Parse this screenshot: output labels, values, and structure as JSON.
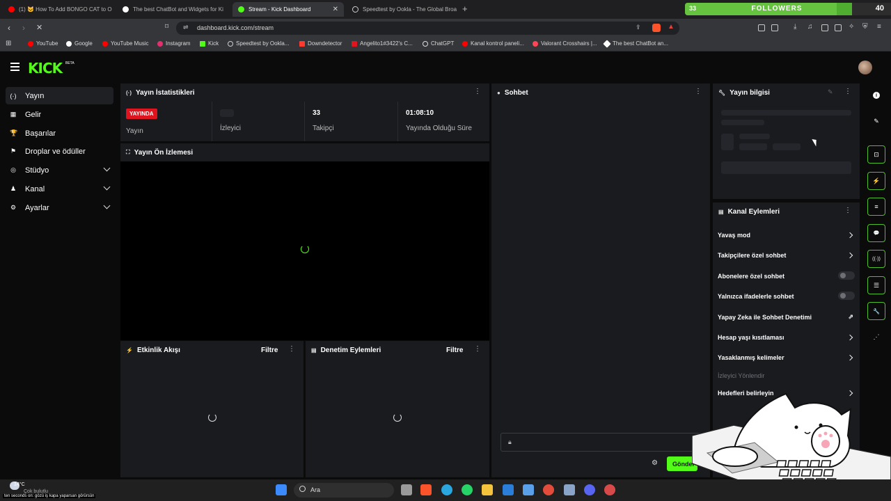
{
  "browser": {
    "tabs": [
      {
        "title": "(1) 🐱 How To Add BONGO CAT to O",
        "icon_color": "#ff0000",
        "active": false
      },
      {
        "title": "The best ChatBot and Widgets for Ki",
        "icon_color": "#ffffff",
        "active": false
      },
      {
        "title": "Stream - Kick Dashboard",
        "icon_color": "#53fc18",
        "active": true
      },
      {
        "title": "Speedtest by Ookla - The Global Broa",
        "icon_color": "#ffffff",
        "active": false
      }
    ],
    "url": "dashboard.kick.com/stream",
    "bookmarks": [
      {
        "label": "YouTube",
        "color": "#ff0000"
      },
      {
        "label": "Google",
        "color": "#ffffff"
      },
      {
        "label": "YouTube Music",
        "color": "#ff0000"
      },
      {
        "label": "Instagram",
        "color": "#e1306c"
      },
      {
        "label": "Kick",
        "color": "#53fc18"
      },
      {
        "label": "Speedtest by Ookla...",
        "color": "#ffffff"
      },
      {
        "label": "Downdetector",
        "color": "#ff3b30"
      },
      {
        "label": "Angelito1#3422's C...",
        "color": "#e0141e"
      },
      {
        "label": "ChatGPT",
        "color": "#ffffff"
      },
      {
        "label": "Kanal kontrol paneli...",
        "color": "#ff0000"
      },
      {
        "label": "Valorant Crosshairs |...",
        "color": "#ff4655"
      },
      {
        "label": "The best ChatBot an...",
        "color": "#ffffff"
      }
    ]
  },
  "followers_widget": {
    "count": "33",
    "label": "FOLLOWERS",
    "goal": "40",
    "progress": 0.825,
    "color": "#4fae2f"
  },
  "app": {
    "logo": "KICK",
    "logo_beta": "BETA",
    "accent": "#53fc18"
  },
  "sidebar": {
    "items": [
      {
        "label": "Yayın",
        "icon": "broadcast-icon",
        "glyph": "(·)",
        "active": true,
        "expandable": false
      },
      {
        "label": "Gelir",
        "icon": "money-icon",
        "glyph": "▦",
        "active": false,
        "expandable": false
      },
      {
        "label": "Başarılar",
        "icon": "trophy-icon",
        "glyph": "🏆",
        "active": false,
        "expandable": false
      },
      {
        "label": "Droplar ve ödüller",
        "icon": "gift-icon",
        "glyph": "⚑",
        "active": false,
        "expandable": false
      },
      {
        "label": "Stüdyo",
        "icon": "studio-icon",
        "glyph": "◎",
        "active": false,
        "expandable": true
      },
      {
        "label": "Kanal",
        "icon": "channel-icon",
        "glyph": "♟",
        "active": false,
        "expandable": true
      },
      {
        "label": "Ayarlar",
        "icon": "gear-icon",
        "glyph": "⚙",
        "active": false,
        "expandable": true
      }
    ]
  },
  "stats_panel": {
    "title": "Yayın İstatistikleri",
    "live_badge": "YAYINDA",
    "cells": [
      {
        "value": "",
        "label": "Yayın"
      },
      {
        "value": "",
        "label": "İzleyici"
      },
      {
        "value": "33",
        "label": "Takipçi"
      },
      {
        "value": "01:08:10",
        "label": "Yayında Olduğu Süre"
      }
    ]
  },
  "preview_panel": {
    "title": "Yayın Ön İzlemesi"
  },
  "activity_panel": {
    "title": "Etkinlik Akışı",
    "filter": "Filtre"
  },
  "moderation_panel": {
    "title": "Denetim Eylemleri",
    "filter": "Filtre"
  },
  "chat_panel": {
    "title": "Sohbet",
    "send_label": "Gönder"
  },
  "info_panel": {
    "title": "Yayın bilgisi"
  },
  "channel_actions": {
    "title": "Kanal Eylemleri",
    "rows": [
      {
        "label": "Yavaş mod",
        "kind": "chevron"
      },
      {
        "label": "Takipçilere özel sohbet",
        "kind": "chevron"
      },
      {
        "label": "Abonelere özel sohbet",
        "kind": "toggle"
      },
      {
        "label": "Yalnızca ifadelerle sohbet",
        "kind": "toggle"
      },
      {
        "label": "Yapay Zeka ile Sohbet Denetimi",
        "kind": "external"
      },
      {
        "label": "Hesap yaşı kısıtlaması",
        "kind": "chevron"
      },
      {
        "label": "Yasaklanmış kelimeler",
        "kind": "chevron"
      },
      {
        "label": "İzleyici Yönlendir",
        "kind": "muted"
      },
      {
        "label": "Hedefleri belirleyin",
        "kind": "chevron"
      }
    ]
  },
  "right_rail": {
    "buttons": [
      {
        "icon": "info-icon",
        "glyph": "i",
        "outlined": false
      },
      {
        "icon": "pencil-icon",
        "glyph": "✎",
        "outlined": false
      },
      {
        "icon": "capture-icon",
        "glyph": "⊡",
        "outlined": true
      },
      {
        "icon": "lightning-icon",
        "glyph": "⚡",
        "outlined": true
      },
      {
        "icon": "list-icon",
        "glyph": "≡",
        "outlined": true
      },
      {
        "icon": "chat-icon",
        "glyph": "💬",
        "outlined": true
      },
      {
        "icon": "broadcast-icon",
        "glyph": "((·))",
        "outlined": true
      },
      {
        "icon": "layout-icon",
        "glyph": "☰",
        "outlined": true
      },
      {
        "icon": "wrench-icon",
        "glyph": "🔧",
        "outlined": true
      },
      {
        "icon": "share-icon",
        "glyph": "⋰",
        "outlined": false
      }
    ]
  },
  "taskbar": {
    "search": "Ara",
    "weather_temp": "14°C",
    "weather_desc": "Çok bulutlu",
    "caption": "ten seconds on: gözü iş kapa yaparsan görürsün",
    "icons": [
      {
        "name": "windows-start-icon",
        "color": "#3b8bff"
      },
      {
        "name": "task-view-icon",
        "color": "#9a9a9a"
      },
      {
        "name": "brave-browser-icon",
        "color": "#fb542b"
      },
      {
        "name": "edge-icon",
        "color": "#2aa7df"
      },
      {
        "name": "whatsapp-icon",
        "color": "#25d366"
      },
      {
        "name": "file-explorer-icon",
        "color": "#f3c33c"
      },
      {
        "name": "mail-icon",
        "color": "#2a7ed8"
      },
      {
        "name": "photos-icon",
        "color": "#5aa0e8"
      },
      {
        "name": "chrome-icon",
        "color": "#e34b3b"
      },
      {
        "name": "settings-app-icon",
        "color": "#8aa4c8"
      },
      {
        "name": "discord-icon",
        "color": "#5865f2"
      },
      {
        "name": "app-icon",
        "color": "#d84a4a"
      }
    ]
  }
}
